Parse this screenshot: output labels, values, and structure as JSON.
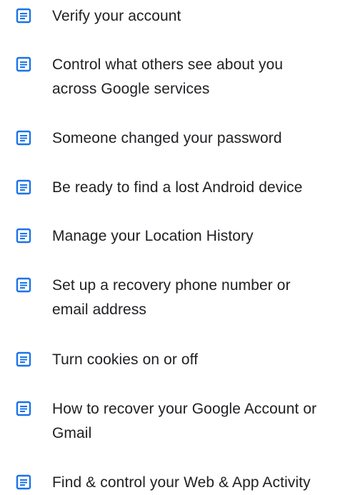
{
  "articles": {
    "items": [
      {
        "label": "Verify your account",
        "icon": "article-icon"
      },
      {
        "label": "Control what others see about you across Google services",
        "icon": "article-icon"
      },
      {
        "label": "Someone changed your password",
        "icon": "article-icon"
      },
      {
        "label": "Be ready to find a lost Android device",
        "icon": "article-icon"
      },
      {
        "label": "Manage your Location History",
        "icon": "article-icon"
      },
      {
        "label": "Set up a recovery phone number or email address",
        "icon": "article-icon"
      },
      {
        "label": "Turn cookies on or off",
        "icon": "article-icon"
      },
      {
        "label": "How to recover your Google Account or Gmail",
        "icon": "article-icon"
      },
      {
        "label": "Find & control your Web & App Activity",
        "icon": "article-icon"
      }
    ]
  },
  "colors": {
    "icon": "#1a73e8",
    "text": "#202124",
    "background": "#ffffff"
  }
}
